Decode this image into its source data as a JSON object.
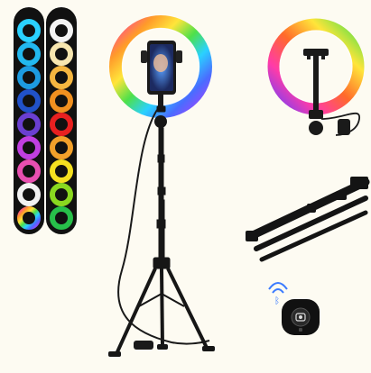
{
  "product": {
    "kind": "rgb-ring-light-with-tripod-stand",
    "strip_a_colors": [
      "#2ad1ff",
      "#22b8ef",
      "#1d9be0",
      "#2152c9",
      "#6a3fd0",
      "#c03fe0",
      "#e84fb0",
      "#f2f2f2",
      "rainbow"
    ],
    "strip_b_colors": [
      "#f4f4f4",
      "#f7e6b0",
      "#f5b640",
      "#f09020",
      "#e82020",
      "#f2a02a",
      "#f4e020",
      "#8ad820",
      "#27c04a"
    ],
    "ring_gradient": [
      "#ff3b3b",
      "#ff9a2a",
      "#ffe53a",
      "#4ee04a",
      "#2ad1ff",
      "#4a6cff",
      "#b03cff",
      "#ff3ba8",
      "#ff3b3b"
    ],
    "accent_black": "#111111"
  }
}
